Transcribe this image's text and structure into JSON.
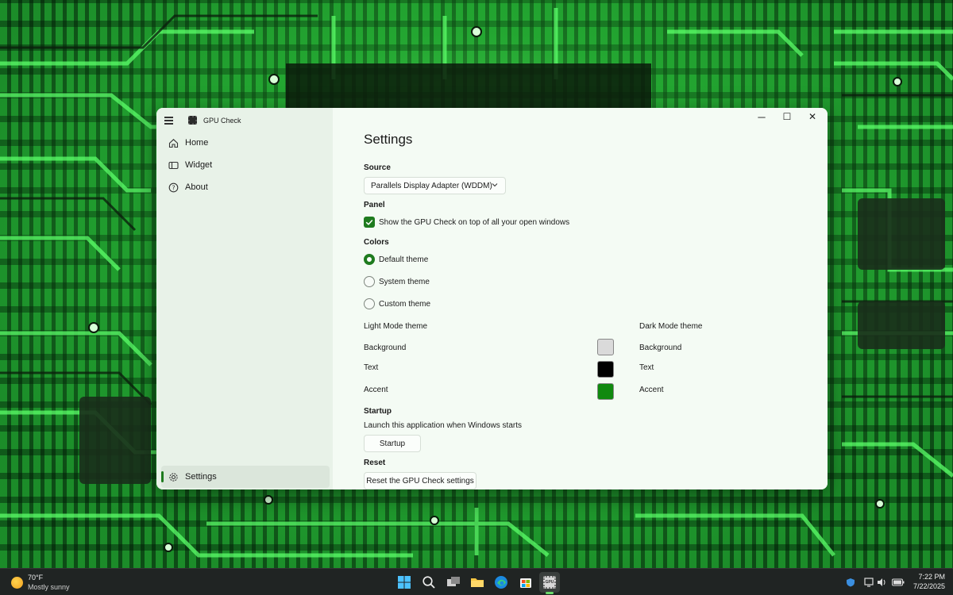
{
  "window": {
    "app_title": "GPU Check",
    "minimize_glyph": "─",
    "maximize_glyph": "☐",
    "close_glyph": "✕"
  },
  "nav": {
    "items": [
      {
        "label": "Home",
        "icon": "home-icon"
      },
      {
        "label": "Widget",
        "icon": "widget-icon"
      },
      {
        "label": "About",
        "icon": "help-icon"
      }
    ],
    "settings": {
      "label": "Settings",
      "icon": "gear-icon",
      "selected": true
    }
  },
  "settings": {
    "title": "Settings",
    "source": {
      "heading": "Source",
      "selected": "Parallels Display Adapter (WDDM)"
    },
    "panel": {
      "heading": "Panel",
      "checkbox_label": "Show the GPU Check on top of all your open windows",
      "checked": true
    },
    "colors": {
      "heading": "Colors",
      "options": [
        {
          "label": "Default theme",
          "selected": true
        },
        {
          "label": "System theme",
          "selected": false
        },
        {
          "label": "Custom theme",
          "selected": false
        }
      ],
      "light": {
        "heading": "Light Mode theme",
        "background_label": "Background",
        "text_label": "Text",
        "accent_label": "Accent",
        "background": "#dadada",
        "text": "#000000",
        "accent": "#10890f"
      },
      "dark": {
        "heading": "Dark Mode theme",
        "background_label": "Background",
        "text_label": "Text",
        "accent_label": "Accent",
        "background": "#222222",
        "text": "#ffffff",
        "accent": "#10890f"
      }
    },
    "startup": {
      "heading": "Startup",
      "description": "Launch this application when Windows starts",
      "button": "Startup"
    },
    "reset": {
      "heading": "Reset",
      "button": "Reset the GPU Check settings"
    }
  },
  "taskbar": {
    "weather_temp": "70°F",
    "weather_desc": "Mostly sunny",
    "apps": [
      "start-icon",
      "search-icon",
      "task-view-icon",
      "file-explorer-icon",
      "edge-icon",
      "store-icon",
      "gpu-check-icon"
    ],
    "gpu_app_label": "GPU",
    "time": "7:22 PM",
    "date": "7/22/2025"
  },
  "colors": {
    "accent": "#1e7b1e",
    "taskbar": "#202423"
  }
}
